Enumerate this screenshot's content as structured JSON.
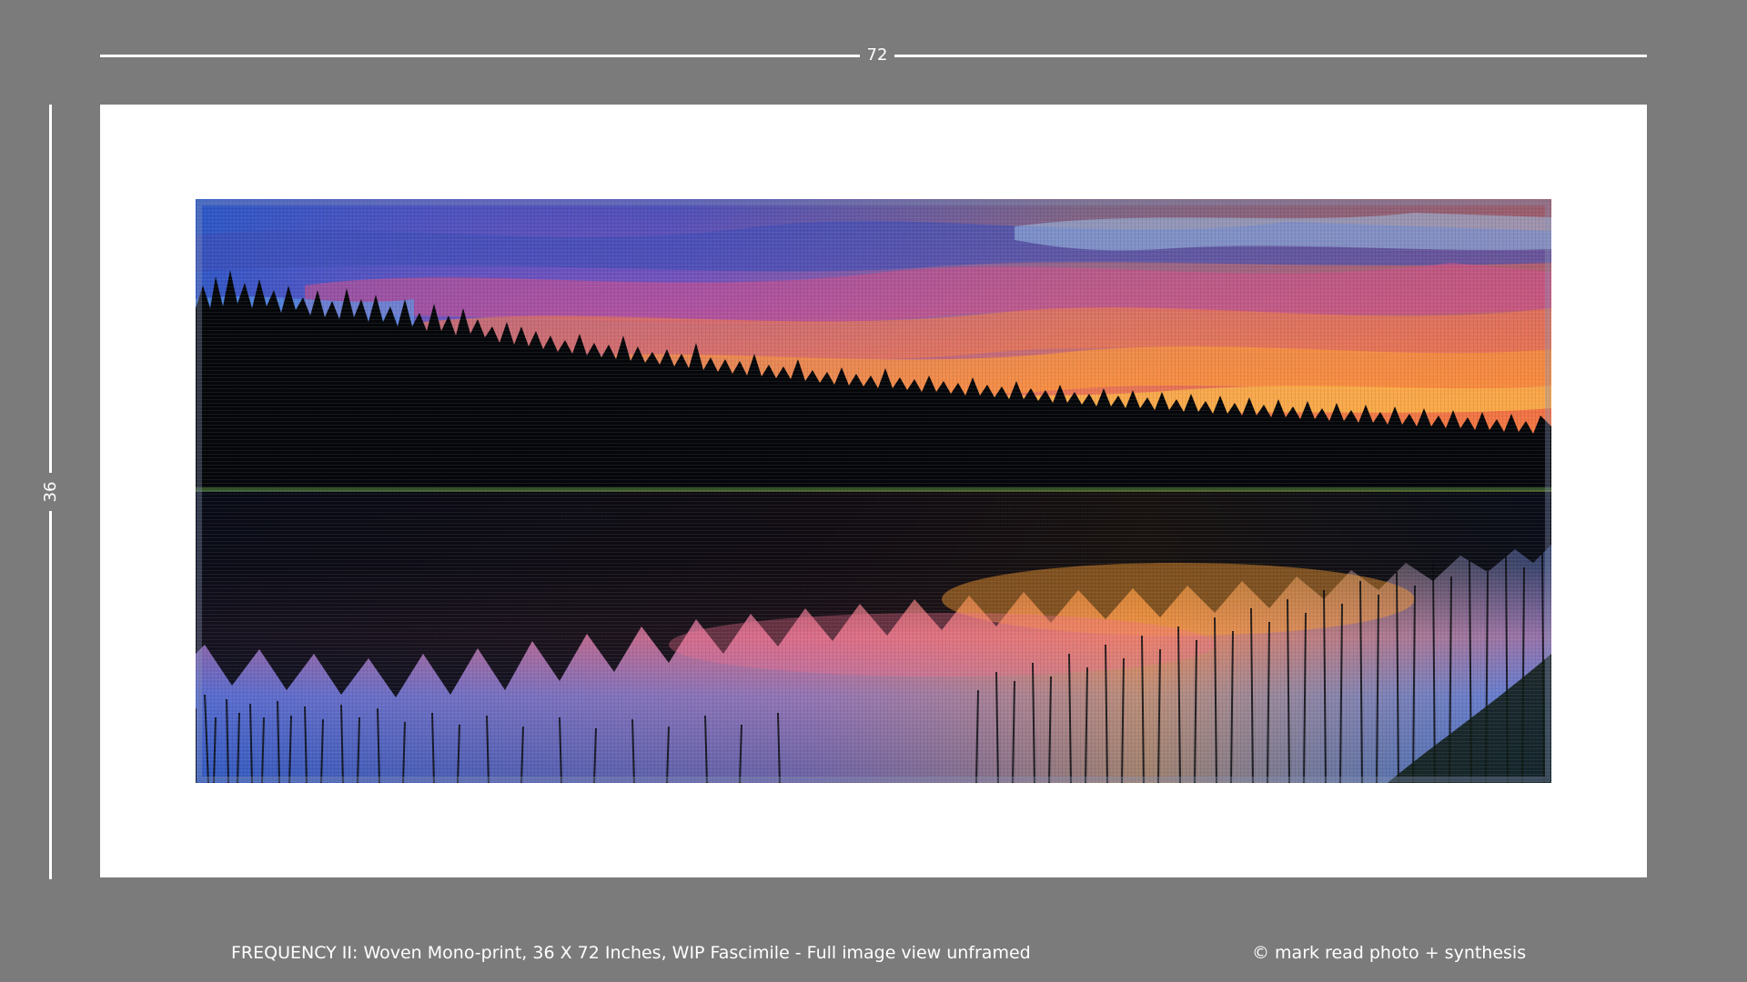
{
  "dimensions": {
    "width_label": "72",
    "height_label": "36"
  },
  "caption": {
    "title": "FREQUENCY II: Woven Mono-print, 36 X 72 Inches, WIP Fascimile - Full image view unframed",
    "copyright": "©  mark read photo + synthesis"
  },
  "colors": {
    "background": "#7b7b7b",
    "mat": "#ffffff",
    "dimension_lines": "#ffffff"
  }
}
